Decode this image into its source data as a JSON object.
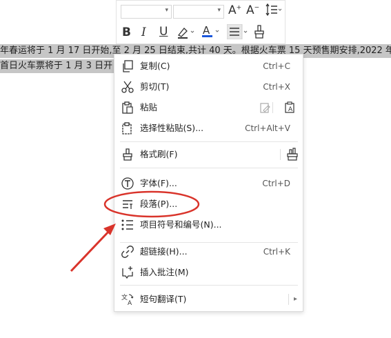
{
  "document": {
    "line1": "年春运将于 1 月 17 日开始,至 2 月 25 日结束,共计 40 天。根据火车票 15 天预售期安排,2022 年",
    "line2": "首日火车票将于 1 月 3 日开"
  },
  "mini_toolbar": {
    "font_name_value": "",
    "font_size_value": "",
    "icons": [
      "grow-font-icon",
      "shrink-font-icon",
      "line-spacing-icon",
      "bold-icon",
      "italic-icon",
      "underline-icon",
      "highlight-icon",
      "font-color-icon",
      "align-icon",
      "format-painter-icon"
    ],
    "bold_glyph": "B",
    "italic_glyph": "I",
    "underline_glyph": "U",
    "font_color_glyph": "A",
    "grow_glyph": "A",
    "shrink_glyph": "A",
    "font_color_accent": "#1a56db"
  },
  "context_menu": {
    "items": [
      {
        "label": "复制(C)",
        "shortcut": "Ctrl+C",
        "icon": "copy-icon"
      },
      {
        "label": "剪切(T)",
        "shortcut": "Ctrl+X",
        "icon": "cut-icon"
      },
      {
        "label": "粘贴",
        "shortcut": "",
        "icon": "paste-icon"
      },
      {
        "label": "选择性粘贴(S)...",
        "shortcut": "Ctrl+Alt+V",
        "icon": "paste-special-icon"
      },
      {
        "label": "格式刷(F)",
        "shortcut": "",
        "icon": "format-painter-icon"
      },
      {
        "label": "字体(F)...",
        "shortcut": "Ctrl+D",
        "icon": "font-icon"
      },
      {
        "label": "段落(P)...",
        "shortcut": "",
        "icon": "paragraph-icon"
      },
      {
        "label": "项目符号和编号(N)...",
        "shortcut": "",
        "icon": "bullets-icon"
      },
      {
        "label": "超链接(H)...",
        "shortcut": "Ctrl+K",
        "icon": "hyperlink-icon"
      },
      {
        "label": "插入批注(M)",
        "shortcut": "",
        "icon": "comment-icon"
      },
      {
        "label": "短句翻译(T)",
        "shortcut": "",
        "icon": "translate-icon"
      }
    ],
    "highlighted_item": "段落(P)..."
  },
  "annotation": {
    "circle_color": "#d9342b",
    "arrow_color": "#d9342b"
  }
}
